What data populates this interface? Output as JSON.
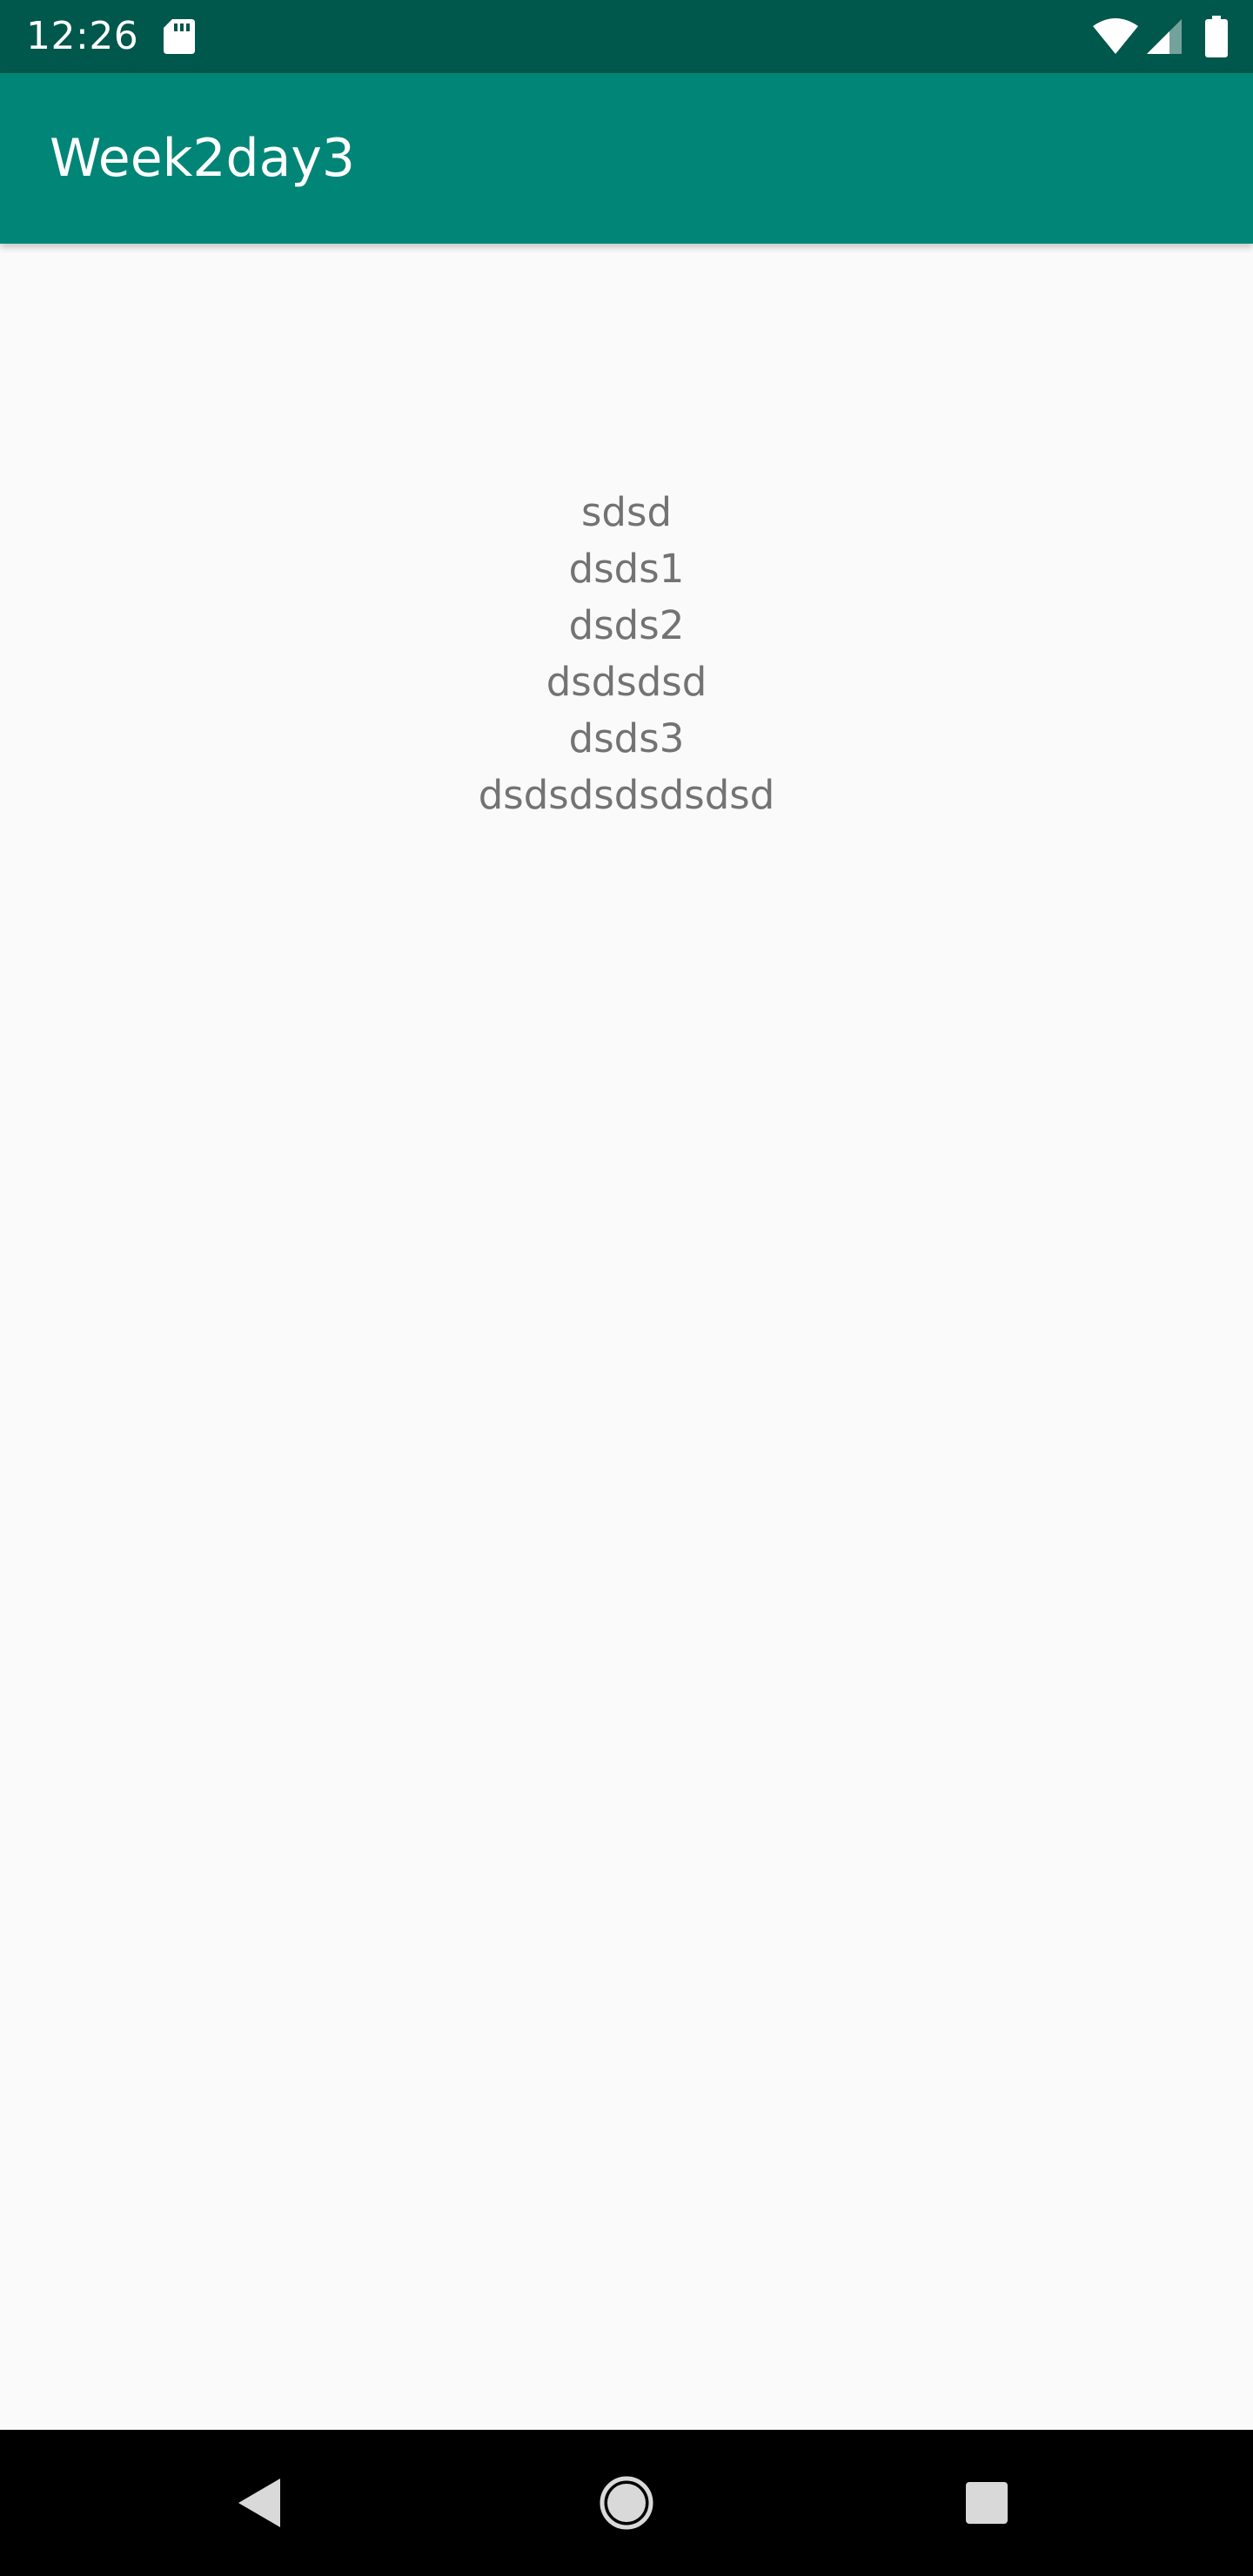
{
  "status_bar": {
    "time": "12:26",
    "icons": [
      "sd-card-icon",
      "wifi-icon",
      "cell-signal-icon",
      "battery-icon"
    ],
    "background_color": "#00574b"
  },
  "app_bar": {
    "title": "Week2day3",
    "background_color": "#008577"
  },
  "content": {
    "lines": [
      "sdsd",
      "dsds1",
      "dsds2",
      "dsdsdsd",
      "dsds3",
      "dsdsdsdsdsdsd"
    ],
    "text_color": "#737373",
    "background_color": "#fafafa"
  },
  "nav_bar": {
    "buttons": [
      "back-icon",
      "home-icon",
      "recents-icon"
    ],
    "background_color": "#000000"
  }
}
